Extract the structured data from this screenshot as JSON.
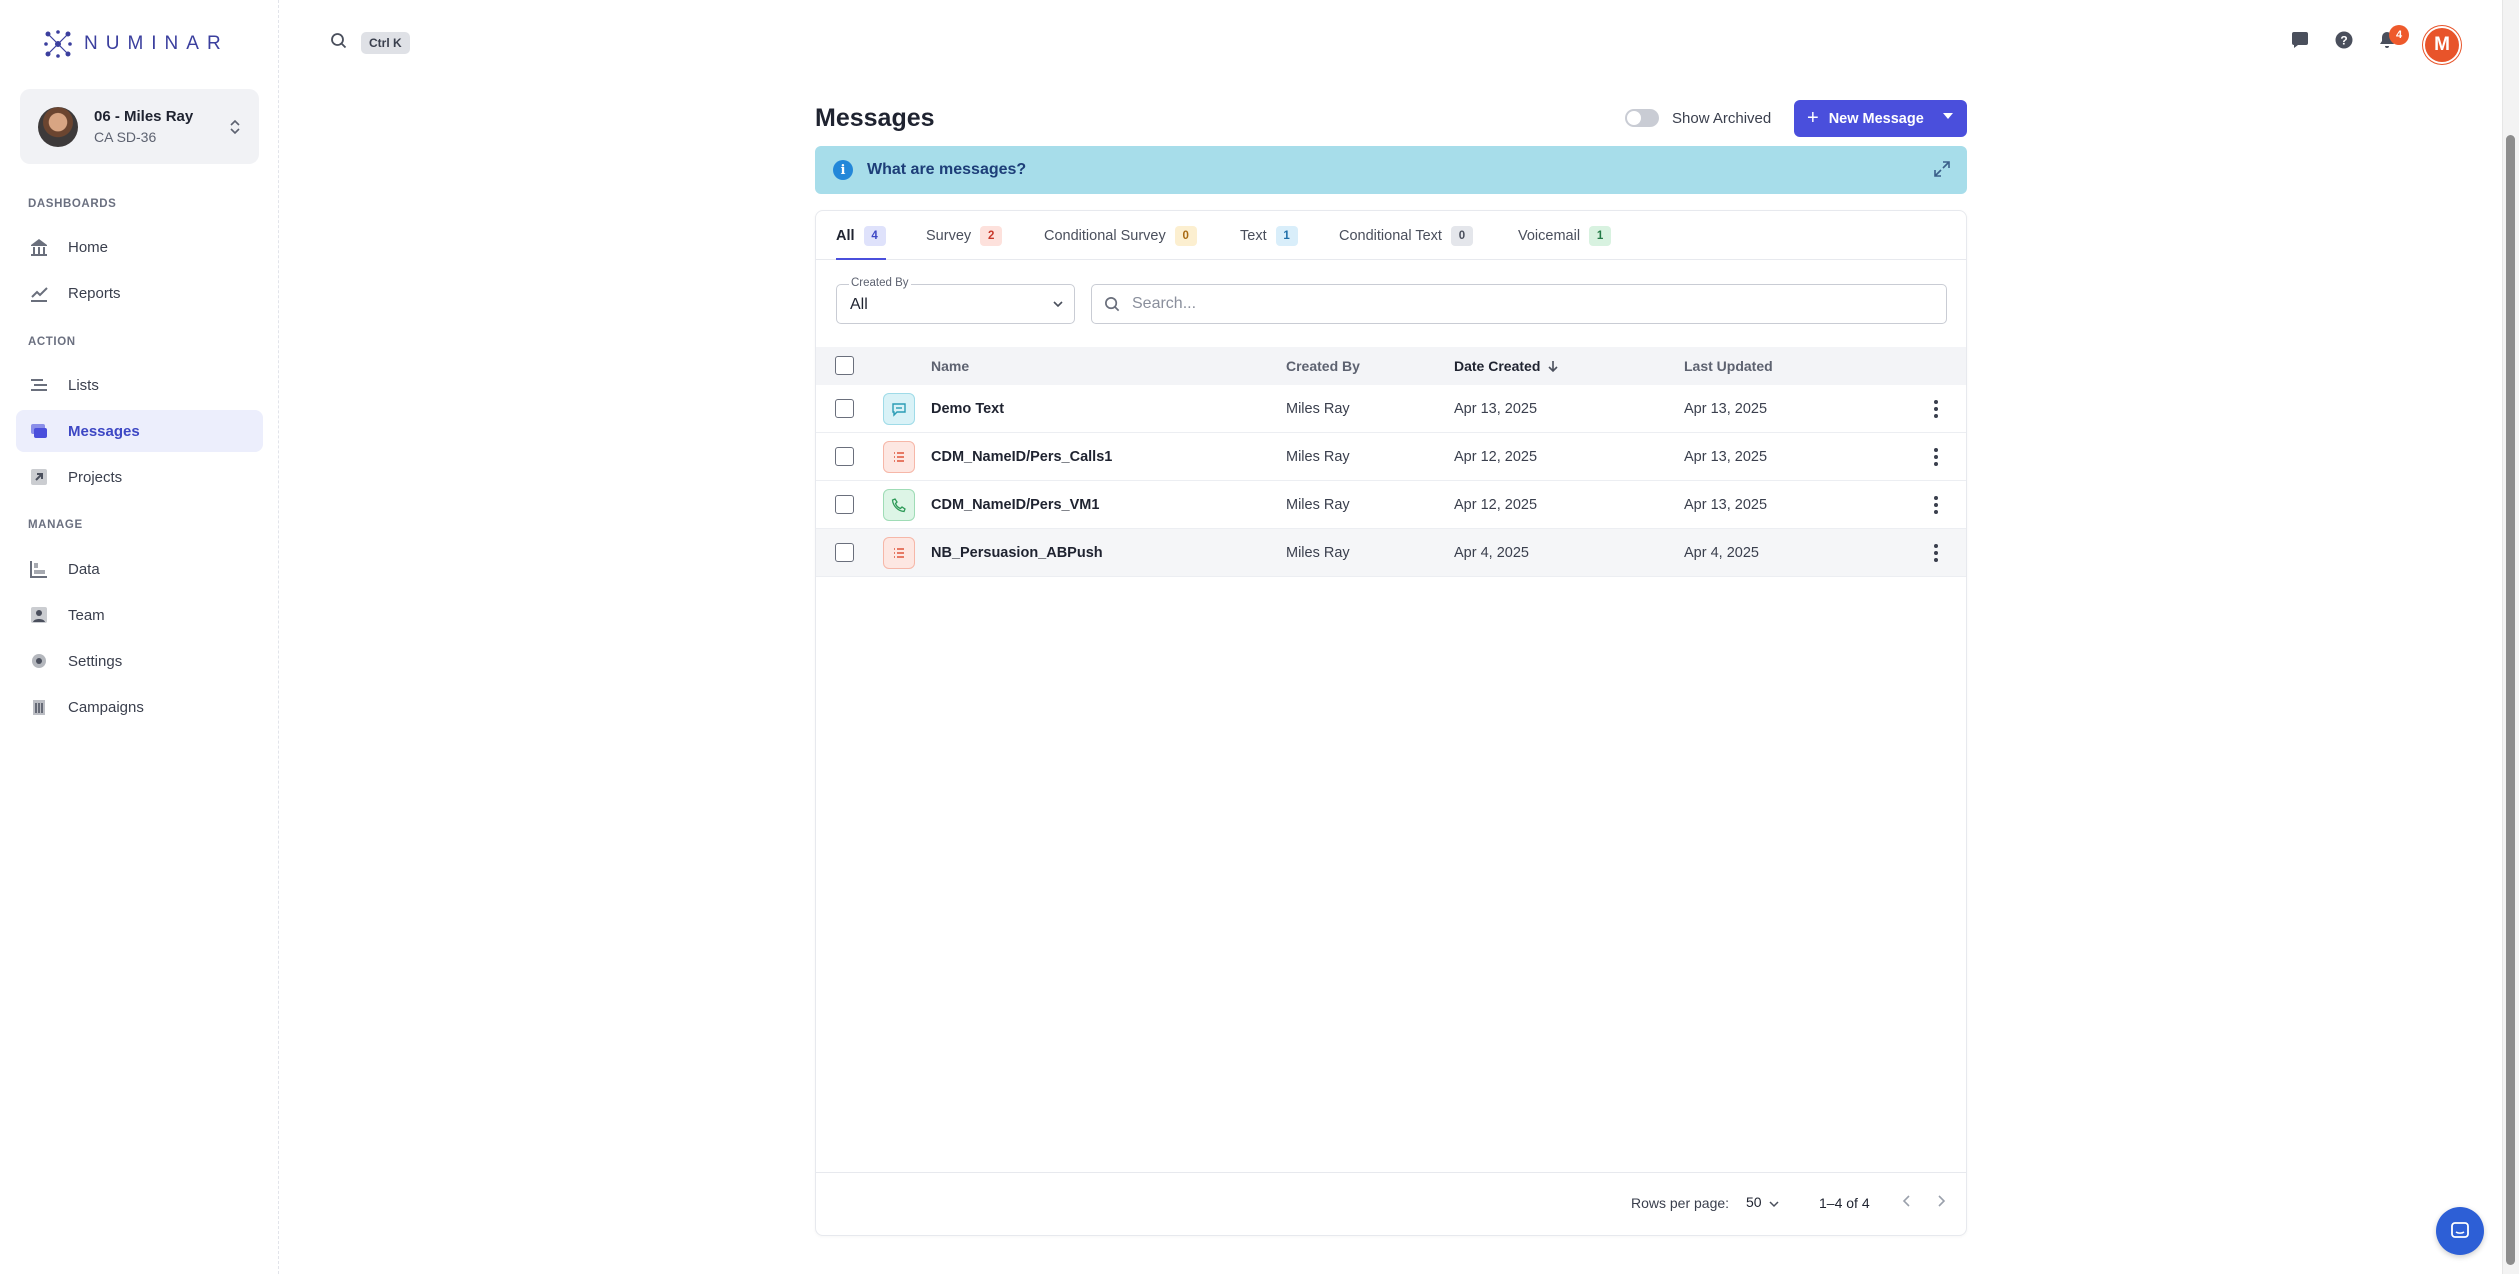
{
  "brand": {
    "name": "NUMINAR"
  },
  "profile": {
    "name": "06 - Miles Ray",
    "subtitle": "CA SD-36"
  },
  "sidebar": {
    "sections": [
      "DASHBOARDS",
      "ACTION",
      "MANAGE"
    ],
    "items": [
      {
        "label": "Home",
        "icon": "home-icon"
      },
      {
        "label": "Reports",
        "icon": "chart-icon"
      },
      {
        "label": "Lists",
        "icon": "list-icon"
      },
      {
        "label": "Messages",
        "icon": "messages-icon",
        "active": true
      },
      {
        "label": "Projects",
        "icon": "arrow-box-icon"
      },
      {
        "label": "Data",
        "icon": "data-icon"
      },
      {
        "label": "Team",
        "icon": "person-icon"
      },
      {
        "label": "Settings",
        "icon": "gear-icon"
      },
      {
        "label": "Campaigns",
        "icon": "building-icon"
      }
    ]
  },
  "topbar": {
    "shortcut": "Ctrl K",
    "notification_count": "4",
    "user_initial": "M"
  },
  "page": {
    "title": "Messages",
    "show_archived_label": "Show Archived",
    "show_archived": false,
    "new_button_label": "New Message",
    "info_text": "What are messages?"
  },
  "tabs": [
    {
      "label": "All",
      "count": "4",
      "active": true
    },
    {
      "label": "Survey",
      "count": "2"
    },
    {
      "label": "Conditional Survey",
      "count": "0"
    },
    {
      "label": "Text",
      "count": "1"
    },
    {
      "label": "Conditional Text",
      "count": "0"
    },
    {
      "label": "Voicemail",
      "count": "1"
    }
  ],
  "filters": {
    "created_by_label": "Created By",
    "created_by_value": "All",
    "search_placeholder": "Search..."
  },
  "table": {
    "columns": [
      "Name",
      "Created By",
      "Date Created",
      "Last Updated"
    ],
    "sorted_column": "Date Created",
    "rows": [
      {
        "type": "text",
        "name": "Demo Text",
        "created_by": "Miles Ray",
        "date_created": "Apr 13, 2025",
        "last_updated": "Apr 13, 2025"
      },
      {
        "type": "survey",
        "name": "CDM_NameID/Pers_Calls1",
        "created_by": "Miles Ray",
        "date_created": "Apr 12, 2025",
        "last_updated": "Apr 13, 2025"
      },
      {
        "type": "voicemail",
        "name": "CDM_NameID/Pers_VM1",
        "created_by": "Miles Ray",
        "date_created": "Apr 12, 2025",
        "last_updated": "Apr 13, 2025"
      },
      {
        "type": "survey",
        "name": "NB_Persuasion_ABPush",
        "created_by": "Miles Ray",
        "date_created": "Apr 4, 2025",
        "last_updated": "Apr 4, 2025"
      }
    ]
  },
  "pagination": {
    "rows_per_page_label": "Rows per page:",
    "rows_per_page": "50",
    "range": "1–4 of 4"
  },
  "colors": {
    "accent": "#4a4fdc",
    "info_bg": "#a7ddea",
    "avatar": "#e8542a"
  }
}
